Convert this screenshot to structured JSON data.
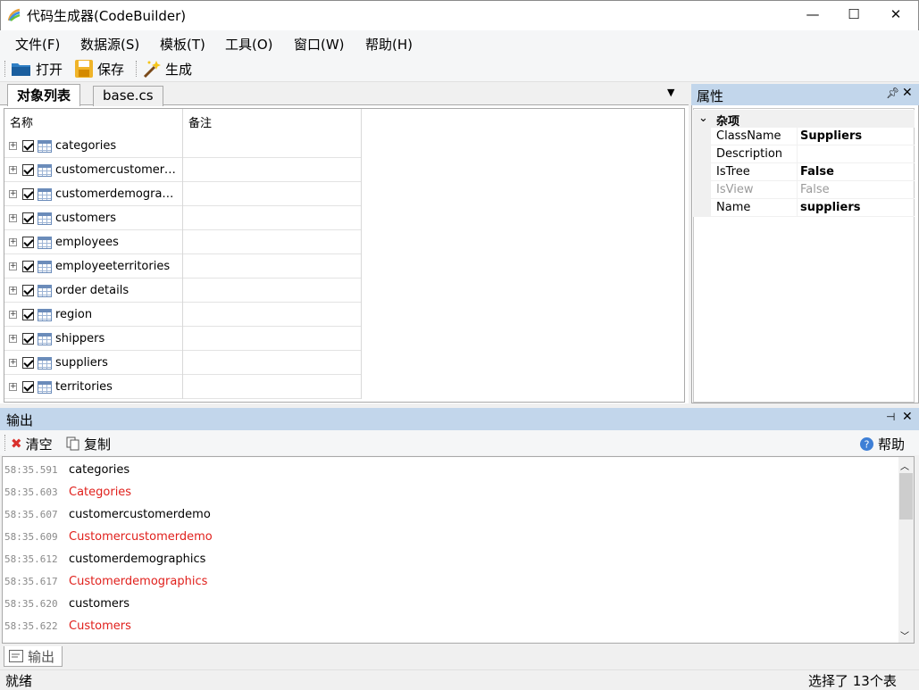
{
  "window": {
    "title": "代码生成器(CodeBuilder)",
    "controls": {
      "minimize": "—",
      "maximize": "☐",
      "close": "✕"
    }
  },
  "menu": [
    "文件(F)",
    "数据源(S)",
    "模板(T)",
    "工具(O)",
    "窗口(W)",
    "帮助(H)"
  ],
  "toolbar": {
    "open_label": "打开",
    "save_label": "保存",
    "generate_label": "生成"
  },
  "doc_tabs": [
    {
      "label": "对象列表",
      "active": true
    },
    {
      "label": "base.cs",
      "active": false
    }
  ],
  "grid": {
    "columns": [
      "名称",
      "备注"
    ],
    "rows": [
      {
        "name": "categories",
        "note": "",
        "checked": true
      },
      {
        "name": "customercustomerd…",
        "note": "",
        "checked": true
      },
      {
        "name": "customerdemograph…",
        "note": "",
        "checked": true
      },
      {
        "name": "customers",
        "note": "",
        "checked": true
      },
      {
        "name": "employees",
        "note": "",
        "checked": true
      },
      {
        "name": "employeeterritories",
        "note": "",
        "checked": true
      },
      {
        "name": "order details",
        "note": "",
        "checked": true
      },
      {
        "name": "region",
        "note": "",
        "checked": true
      },
      {
        "name": "shippers",
        "note": "",
        "checked": true
      },
      {
        "name": "suppliers",
        "note": "",
        "checked": true
      },
      {
        "name": "territories",
        "note": "",
        "checked": true
      }
    ]
  },
  "properties": {
    "title": "属性",
    "category": "杂项",
    "items": [
      {
        "key": "ClassName",
        "value": "Suppliers",
        "bold": true,
        "disabled": false
      },
      {
        "key": "Description",
        "value": "",
        "bold": false,
        "disabled": false
      },
      {
        "key": "IsTree",
        "value": "False",
        "bold": true,
        "disabled": false
      },
      {
        "key": "IsView",
        "value": "False",
        "bold": false,
        "disabled": true
      },
      {
        "key": "Name",
        "value": "suppliers",
        "bold": true,
        "disabled": false
      }
    ]
  },
  "output": {
    "title": "输出",
    "clear_label": "清空",
    "copy_label": "复制",
    "help_label": "帮助",
    "tab_label": "输出",
    "lines": [
      {
        "ts": "58:35.591",
        "text": "categories",
        "color": "black"
      },
      {
        "ts": "58:35.603",
        "text": "Categories",
        "color": "red"
      },
      {
        "ts": "58:35.607",
        "text": "customercustomerdemo",
        "color": "black"
      },
      {
        "ts": "58:35.609",
        "text": "Customercustomerdemo",
        "color": "red"
      },
      {
        "ts": "58:35.612",
        "text": "customerdemographics",
        "color": "black"
      },
      {
        "ts": "58:35.617",
        "text": "Customerdemographics",
        "color": "red"
      },
      {
        "ts": "58:35.620",
        "text": "customers",
        "color": "black"
      },
      {
        "ts": "58:35.622",
        "text": "Customers",
        "color": "red"
      }
    ]
  },
  "status": {
    "left": "就绪",
    "right": "选择了 13个表"
  },
  "colors": {
    "panel_header": "#c2d6eb",
    "log_red": "#e0201c"
  }
}
